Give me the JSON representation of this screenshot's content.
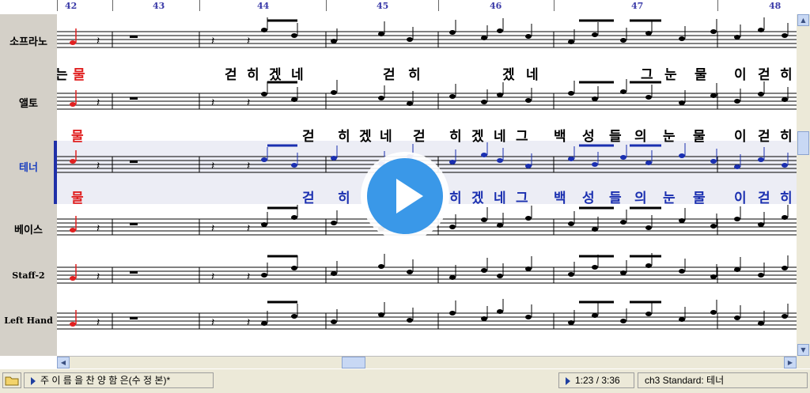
{
  "ruler": {
    "measures": [
      "42",
      "43",
      "44",
      "45",
      "46",
      "47",
      "48"
    ]
  },
  "tracks": [
    {
      "label": "소프라노",
      "active": false
    },
    {
      "label": "앨토",
      "active": false
    },
    {
      "label": "테너",
      "active": true
    },
    {
      "label": "베이스",
      "active": false
    },
    {
      "label": "Staff-2",
      "active": false
    },
    {
      "label": "Left Hand",
      "active": false
    }
  ],
  "lyrics": {
    "soprano": [
      "는",
      "물",
      "걷",
      "히",
      "겠",
      "네",
      "걷",
      "히",
      "겠",
      "네",
      "그",
      "눈",
      "물",
      "이",
      "걷",
      "히"
    ],
    "alto": [
      "물",
      "걷",
      "히",
      "겠",
      "네",
      "걷",
      "히",
      "겠",
      "네",
      "그",
      "백",
      "성",
      "들",
      "의",
      "눈",
      "물",
      "이",
      "걷",
      "히"
    ],
    "tenor": [
      "물",
      "걷",
      "히",
      "히",
      "겠",
      "네",
      "그",
      "백",
      "성",
      "들",
      "의",
      "눈",
      "물",
      "이",
      "걷",
      "히"
    ]
  },
  "status": {
    "folder_icon": "folder-icon",
    "song_title": "주 이 름 을 찬 양 함 은(수 정 본)*",
    "time": "1:23 / 3:36",
    "channel": "ch3 Standard: 테너"
  },
  "colors": {
    "accent_red": "#e02020",
    "tenor_blue": "#1a2fb0",
    "measure_numbers": "#3a3aa8",
    "play_button": "#3a98e8"
  },
  "overlay": {
    "icon": "play-icon"
  }
}
